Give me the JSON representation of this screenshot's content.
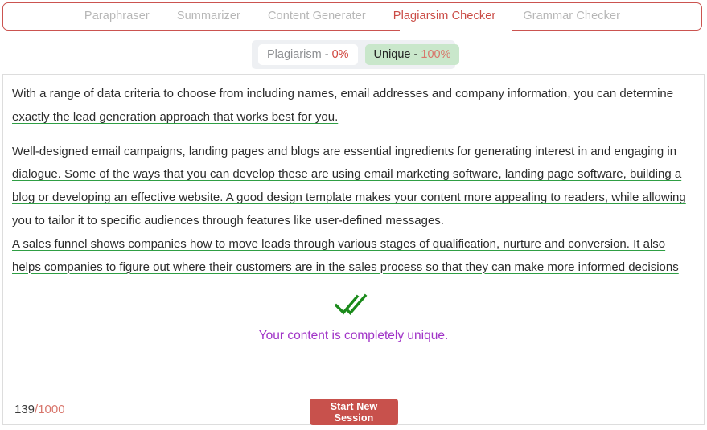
{
  "tabs": {
    "items": [
      {
        "label": "Paraphraser",
        "active": false
      },
      {
        "label": "Summarizer",
        "active": false
      },
      {
        "label": "Content Generater",
        "active": false
      },
      {
        "label": "Plagiarsim Checker",
        "active": true
      },
      {
        "label": "Grammar Checker",
        "active": false
      }
    ],
    "active_color": "#ca4b45",
    "inactive_color": "#b7b7b7",
    "border_color": "#cb5450"
  },
  "scores": {
    "plagiarism": {
      "label": "Plagiarism - ",
      "value": "0%",
      "background": "#ffffff",
      "value_color": "#d0453d"
    },
    "unique": {
      "label": "Unique - ",
      "value": "100%",
      "background": "#c9e7cb",
      "value_color": "#d8756b"
    },
    "container_background": "#eef0f3"
  },
  "content": {
    "paragraphs": [
      "With a range of data criteria to choose from including names, email addresses and company information, you can determine exactly the lead generation approach that works best for you.",
      "Well-designed email campaigns, landing pages and blogs are essential ingredients for generating interest in and engaging in dialogue. Some of the ways that you can develop these are using email marketing software, landing page software, building a blog or developing an effective website. A good design template makes your content more appealing to readers, while allowing you to tailor it to specific audiences through features like user-defined messages.",
      "A sales funnel shows companies how to move leads through various stages of qualification, nurture and conversion. It also helps companies to figure out where their customers are in the sales process so that they can make more informed decisions"
    ],
    "underline_color": "#2f9e44",
    "text_color": "#2c2c2c"
  },
  "result": {
    "icon": "double-check-icon",
    "icon_color": "#1a8a1a",
    "message": "Your content is completely unique.",
    "message_color": "#a033c7"
  },
  "footer": {
    "word_count": "139",
    "word_limit": "/1000",
    "button_label": "Start New Session",
    "button_color": "#c8514c"
  }
}
